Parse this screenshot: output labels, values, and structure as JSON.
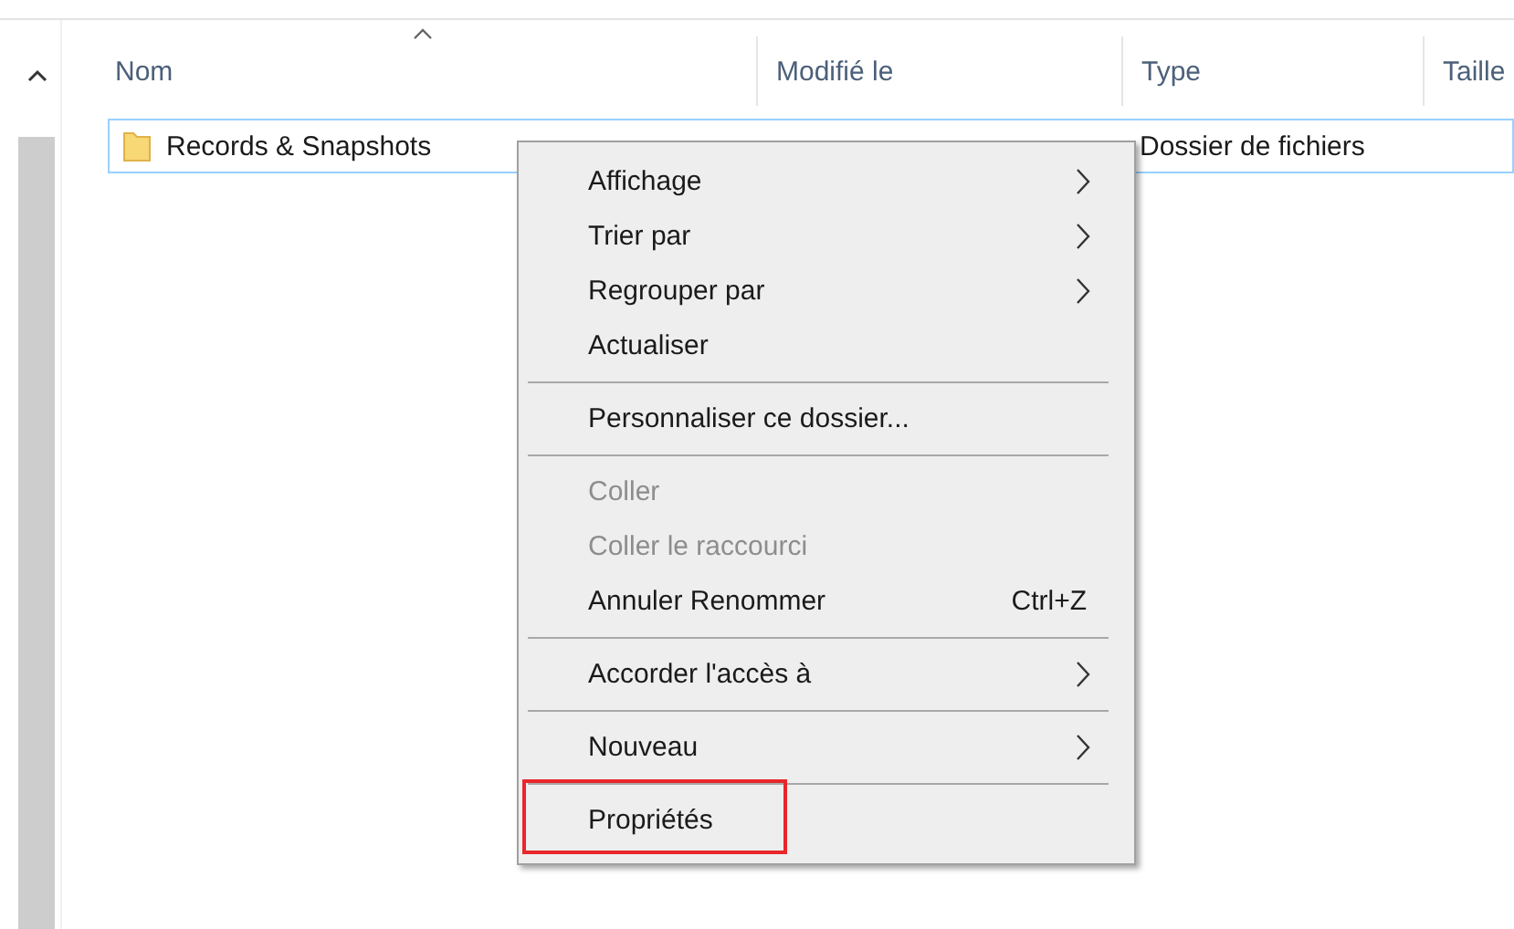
{
  "columns": [
    {
      "label": "Nom",
      "sorted": true
    },
    {
      "label": "Modifié le",
      "sorted": false
    },
    {
      "label": "Type",
      "sorted": false
    },
    {
      "label": "Taille",
      "sorted": false
    }
  ],
  "rows": [
    {
      "name": "Records & Snapshots",
      "type": "Dossier de fichiers",
      "selected": true
    }
  ],
  "context_menu": [
    {
      "kind": "item",
      "label": "Affichage",
      "submenu": true,
      "disabled": false,
      "highlighted": false
    },
    {
      "kind": "item",
      "label": "Trier par",
      "submenu": true,
      "disabled": false,
      "highlighted": false
    },
    {
      "kind": "item",
      "label": "Regrouper par",
      "submenu": true,
      "disabled": false,
      "highlighted": false
    },
    {
      "kind": "item",
      "label": "Actualiser",
      "submenu": false,
      "disabled": false,
      "highlighted": false
    },
    {
      "kind": "separator"
    },
    {
      "kind": "item",
      "label": "Personnaliser ce dossier...",
      "submenu": false,
      "disabled": false,
      "highlighted": false
    },
    {
      "kind": "separator"
    },
    {
      "kind": "item",
      "label": "Coller",
      "submenu": false,
      "disabled": true,
      "highlighted": false
    },
    {
      "kind": "item",
      "label": "Coller le raccourci",
      "submenu": false,
      "disabled": true,
      "highlighted": false
    },
    {
      "kind": "item",
      "label": "Annuler Renommer",
      "shortcut": "Ctrl+Z",
      "submenu": false,
      "disabled": false,
      "highlighted": false
    },
    {
      "kind": "separator"
    },
    {
      "kind": "item",
      "label": "Accorder l'accès à",
      "submenu": true,
      "disabled": false,
      "highlighted": false
    },
    {
      "kind": "separator"
    },
    {
      "kind": "item",
      "label": "Nouveau",
      "submenu": true,
      "disabled": false,
      "highlighted": false
    },
    {
      "kind": "separator"
    },
    {
      "kind": "item",
      "label": "Propriétés",
      "submenu": false,
      "disabled": false,
      "highlighted": true
    }
  ]
}
